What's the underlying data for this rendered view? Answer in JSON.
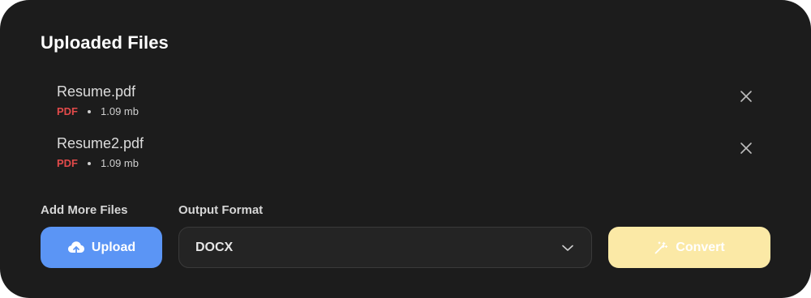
{
  "title": "Uploaded Files",
  "files": [
    {
      "name": "Resume.pdf",
      "type": "PDF",
      "size": "1.09 mb"
    },
    {
      "name": "Resume2.pdf",
      "type": "PDF",
      "size": "1.09 mb"
    }
  ],
  "add_more": {
    "label": "Add More Files",
    "button_label": "Upload",
    "icon": "cloud-upload-icon"
  },
  "output_format": {
    "label": "Output Format",
    "selected": "DOCX",
    "icon": "chevron-down-icon"
  },
  "convert": {
    "label": "Convert",
    "icon": "magic-wand-icon"
  },
  "colors": {
    "panel_bg": "#1c1c1c",
    "file_type": "#e24a4a",
    "upload_button": "#5b95f5",
    "convert_button": "#fbe9a6"
  }
}
